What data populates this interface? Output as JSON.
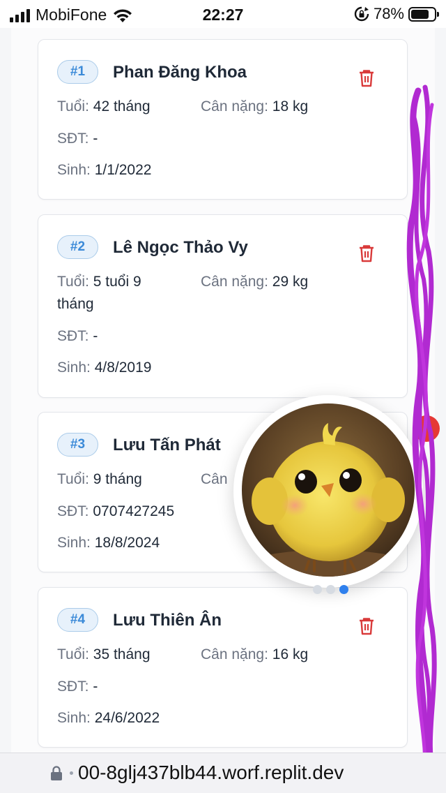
{
  "status_bar": {
    "carrier": "MobiFone",
    "time": "22:27",
    "battery_percent": "78%",
    "battery_level": 0.78,
    "icons": [
      "signal-icon",
      "wifi-icon",
      "rotation-lock-icon",
      "battery-icon"
    ]
  },
  "labels": {
    "age": "Tuổi:",
    "weight": "Cân nặng:",
    "phone": "SĐT:",
    "birth": "Sinh:"
  },
  "cards": [
    {
      "badge": "#1",
      "name": "Phan Đăng Khoa",
      "age": "42 tháng",
      "weight": "18 kg",
      "phone": "-",
      "birth": "1/1/2022"
    },
    {
      "badge": "#2",
      "name": "Lê Ngọc Thảo Vy",
      "age_line1": "5 tuổi 9",
      "age_line2": "tháng",
      "weight": "29 kg",
      "phone": "-",
      "birth": "4/8/2019"
    },
    {
      "badge": "#3",
      "name": "Lưu Tấn Phát",
      "age": "9 tháng",
      "weight_label_partial": "Cân",
      "phone": "0707427245",
      "birth": "18/8/2024"
    },
    {
      "badge": "#4",
      "name": "Lưu Thiên Ân",
      "age": "35 tháng",
      "weight": "16 kg",
      "phone": "-",
      "birth": "24/6/2022"
    }
  ],
  "carousel": {
    "image": "yellow-chick-avatar",
    "dots": 3,
    "active_dot": 3
  },
  "url_bar": {
    "url": "00-8glj437blb44.worf.replit.dev",
    "icon": "padlock-icon"
  },
  "colors": {
    "badge_text": "#3b8ad8",
    "badge_bg": "#e7f1fb",
    "trash": "#d93a3a",
    "scribble": "#b12ad1",
    "active_dot": "#2f80ed"
  }
}
